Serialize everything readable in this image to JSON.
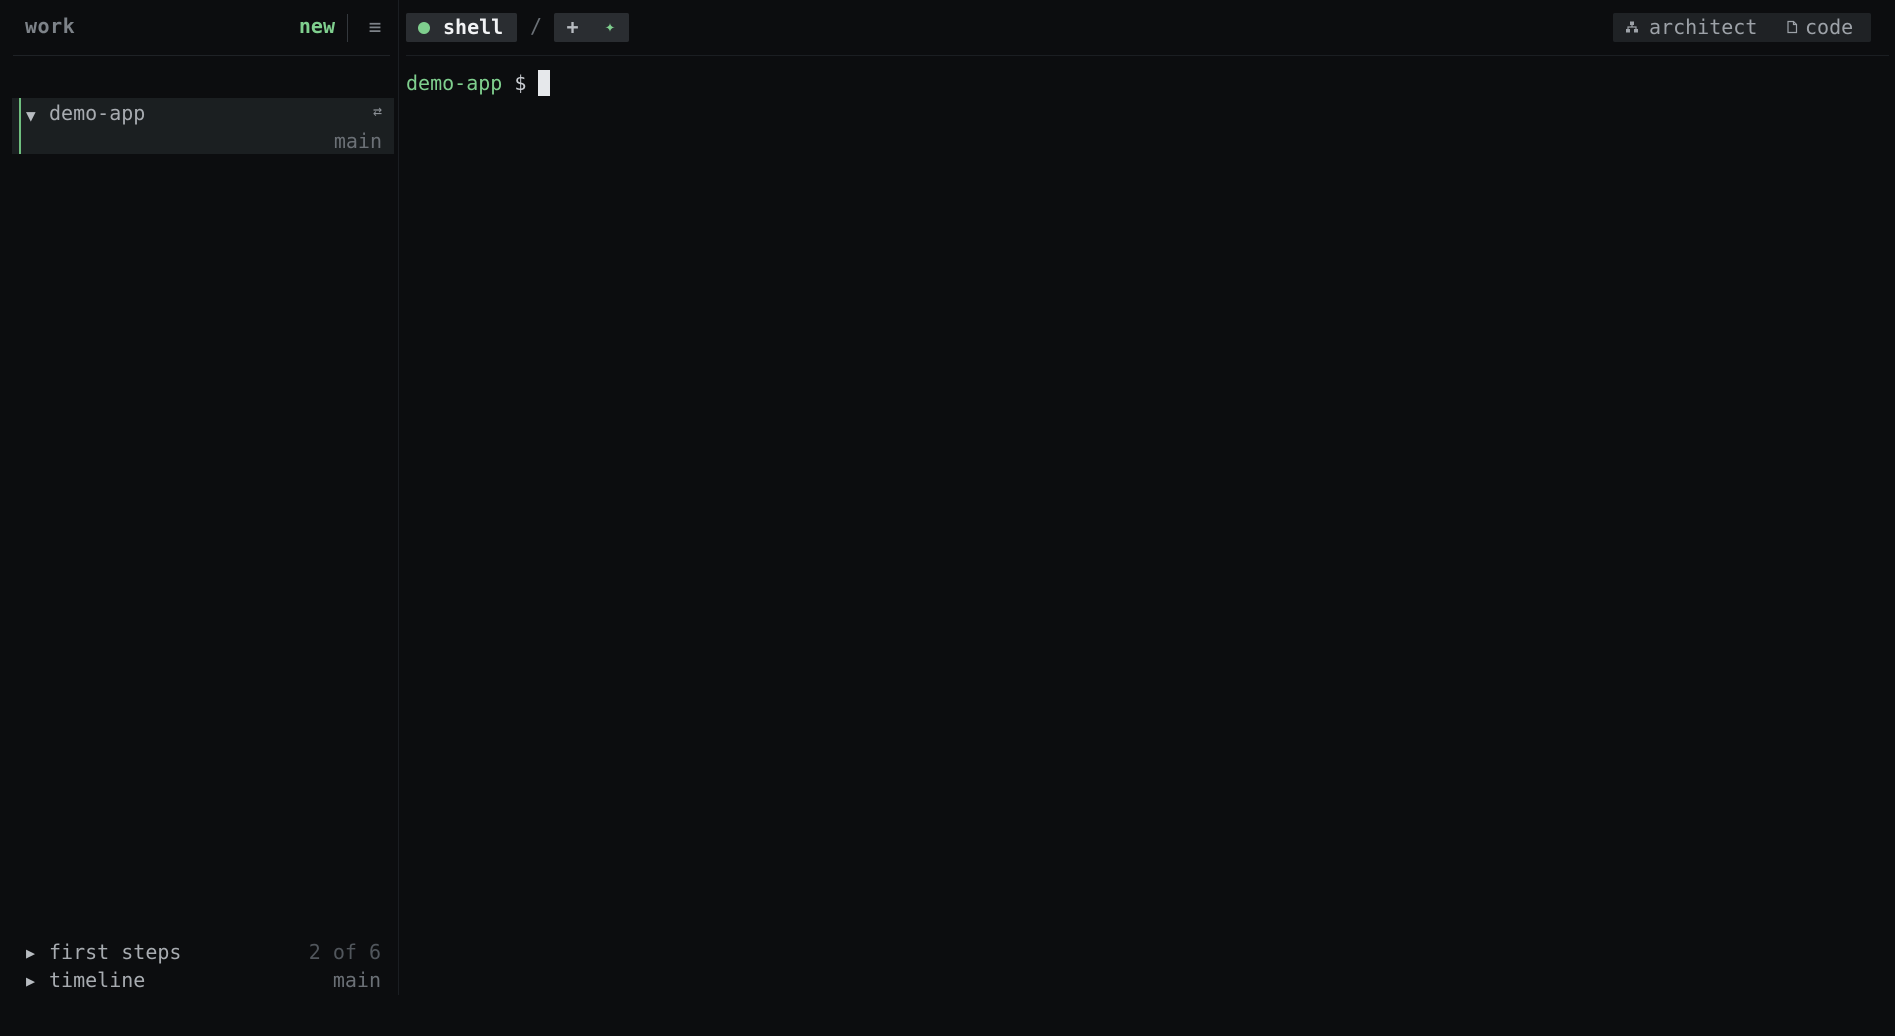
{
  "sidebar": {
    "title": "work",
    "new_label": "new",
    "menu_icon": "≡",
    "project": {
      "name": "demo-app",
      "branch": "main",
      "switch_icon": "⇄"
    },
    "footer": {
      "first_steps": {
        "label": "first steps",
        "progress": "2 of 6"
      },
      "timeline": {
        "label": "timeline",
        "branch": "main"
      }
    }
  },
  "topbar": {
    "tabs": [
      {
        "label": "shell",
        "status_color": "#7fcf8e",
        "active": true
      }
    ],
    "separator": "/",
    "add_icon": "+",
    "spark_icon": "✦",
    "views": {
      "architect": "architect",
      "code": "code"
    }
  },
  "terminal": {
    "prompt_dir": "demo-app",
    "prompt_symbol": "$"
  },
  "colors": {
    "accent": "#7fcf8e",
    "background": "#0c0d0f"
  }
}
